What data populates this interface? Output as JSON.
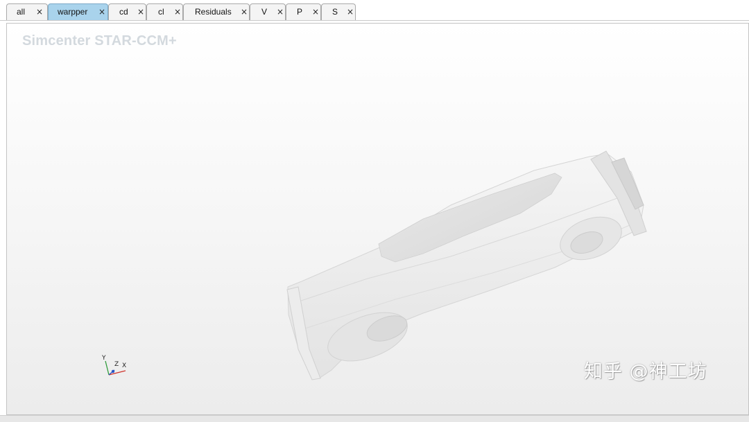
{
  "tabs": [
    {
      "label": "all",
      "active": false
    },
    {
      "label": "warpper",
      "active": true
    },
    {
      "label": "cd",
      "active": false
    },
    {
      "label": "cl",
      "active": false
    },
    {
      "label": "Residuals",
      "active": false
    },
    {
      "label": "V",
      "active": false
    },
    {
      "label": "P",
      "active": false
    },
    {
      "label": "S",
      "active": false
    }
  ],
  "close_glyph": "×",
  "viewport": {
    "brand": "Simcenter STAR-CCM+",
    "triad": {
      "y": "Y",
      "z": "Z",
      "x": "X"
    }
  },
  "watermark": "知乎 @神工坊",
  "colors": {
    "active_tab": "#a9d3ec",
    "axis_x": "#d0342c",
    "axis_y": "#2e9b3a",
    "axis_z": "#2a56c6"
  }
}
